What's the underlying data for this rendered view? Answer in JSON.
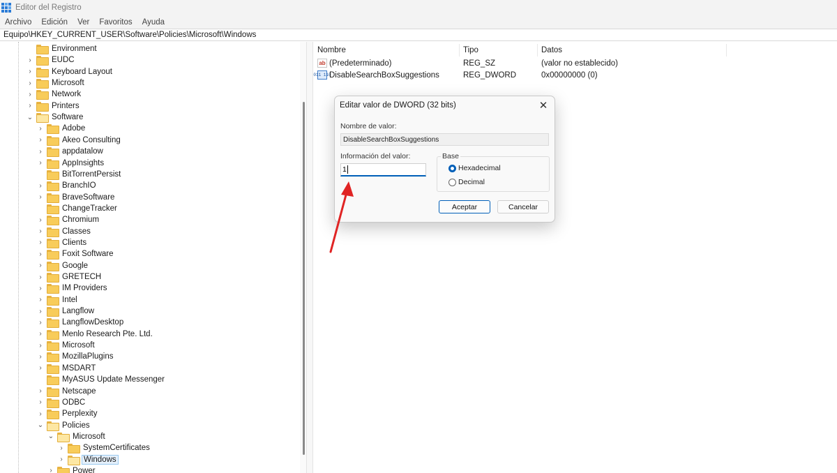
{
  "window": {
    "title": "Editor del Registro"
  },
  "menu": [
    "Archivo",
    "Edición",
    "Ver",
    "Favoritos",
    "Ayuda"
  ],
  "address": "Equipo\\HKEY_CURRENT_USER\\Software\\Policies\\Microsoft\\Windows",
  "tree": [
    {
      "label": "Environment",
      "expander": "",
      "selected": false,
      "open": false
    },
    {
      "label": "EUDC",
      "expander": "›",
      "selected": false,
      "open": false
    },
    {
      "label": "Keyboard Layout",
      "expander": "›",
      "selected": false,
      "open": false
    },
    {
      "label": "Microsoft",
      "expander": "›",
      "selected": false,
      "open": false
    },
    {
      "label": "Network",
      "expander": "›",
      "selected": false,
      "open": false
    },
    {
      "label": "Printers",
      "expander": "›",
      "selected": false,
      "open": false
    },
    {
      "label": "Software",
      "expander": "⌄",
      "selected": false,
      "open": true
    },
    {
      "label": "Adobe",
      "expander": "›",
      "selected": false,
      "open": false
    },
    {
      "label": "Akeo Consulting",
      "expander": "›",
      "selected": false,
      "open": false
    },
    {
      "label": "appdatalow",
      "expander": "›",
      "selected": false,
      "open": false
    },
    {
      "label": "AppInsights",
      "expander": "›",
      "selected": false,
      "open": false
    },
    {
      "label": "BitTorrentPersist",
      "expander": "",
      "selected": false,
      "open": false
    },
    {
      "label": "BranchIO",
      "expander": "›",
      "selected": false,
      "open": false
    },
    {
      "label": "BraveSoftware",
      "expander": "›",
      "selected": false,
      "open": false
    },
    {
      "label": "ChangeTracker",
      "expander": "",
      "selected": false,
      "open": false
    },
    {
      "label": "Chromium",
      "expander": "›",
      "selected": false,
      "open": false
    },
    {
      "label": "Classes",
      "expander": "›",
      "selected": false,
      "open": false
    },
    {
      "label": "Clients",
      "expander": "›",
      "selected": false,
      "open": false
    },
    {
      "label": "Foxit Software",
      "expander": "›",
      "selected": false,
      "open": false
    },
    {
      "label": "Google",
      "expander": "›",
      "selected": false,
      "open": false
    },
    {
      "label": "GRETECH",
      "expander": "›",
      "selected": false,
      "open": false
    },
    {
      "label": "IM Providers",
      "expander": "›",
      "selected": false,
      "open": false
    },
    {
      "label": "Intel",
      "expander": "›",
      "selected": false,
      "open": false
    },
    {
      "label": "Langflow",
      "expander": "›",
      "selected": false,
      "open": false
    },
    {
      "label": "LangflowDesktop",
      "expander": "›",
      "selected": false,
      "open": false
    },
    {
      "label": "Menlo Research Pte. Ltd.",
      "expander": "›",
      "selected": false,
      "open": false
    },
    {
      "label": "Microsoft",
      "expander": "›",
      "selected": false,
      "open": false
    },
    {
      "label": "MozillaPlugins",
      "expander": "›",
      "selected": false,
      "open": false
    },
    {
      "label": "MSDART",
      "expander": "›",
      "selected": false,
      "open": false
    },
    {
      "label": "MyASUS Update Messenger",
      "expander": "",
      "selected": false,
      "open": false
    },
    {
      "label": "Netscape",
      "expander": "›",
      "selected": false,
      "open": false
    },
    {
      "label": "ODBC",
      "expander": "›",
      "selected": false,
      "open": false
    },
    {
      "label": "Perplexity",
      "expander": "›",
      "selected": false,
      "open": false
    },
    {
      "label": "Policies",
      "expander": "⌄",
      "selected": false,
      "open": true
    },
    {
      "label": "Microsoft",
      "expander": "⌄",
      "selected": false,
      "open": true
    },
    {
      "label": "SystemCertificates",
      "expander": "›",
      "selected": false,
      "open": false
    },
    {
      "label": "Windows",
      "expander": "›",
      "selected": true,
      "open": true
    },
    {
      "label": "Power",
      "expander": "›",
      "selected": false,
      "open": false
    }
  ],
  "list": {
    "columns": [
      "Nombre",
      "Tipo",
      "Datos"
    ],
    "rows": [
      {
        "icon": "string-value-icon",
        "icon_text": "ab",
        "name": "(Predeterminado)",
        "type": "REG_SZ",
        "data": "(valor no establecido)"
      },
      {
        "icon": "binary-value-icon",
        "icon_text": "011 110",
        "name": "DisableSearchBoxSuggestions",
        "type": "REG_DWORD",
        "data": "0x00000000 (0)"
      }
    ]
  },
  "dialog": {
    "title": "Editar valor de DWORD (32 bits)",
    "close_glyph": "✕",
    "name_label": "Nombre de valor:",
    "name_value": "DisableSearchBoxSuggestions",
    "value_label": "Información del valor:",
    "value": "1",
    "base_label": "Base",
    "base_options": [
      "Hexadecimal",
      "Decimal"
    ],
    "base_selected": "Hexadecimal",
    "ok_label": "Aceptar",
    "cancel_label": "Cancelar"
  },
  "colors": {
    "accent": "#005fb8",
    "annotation_arrow": "#e02424",
    "folder": "#f8cc5a"
  }
}
